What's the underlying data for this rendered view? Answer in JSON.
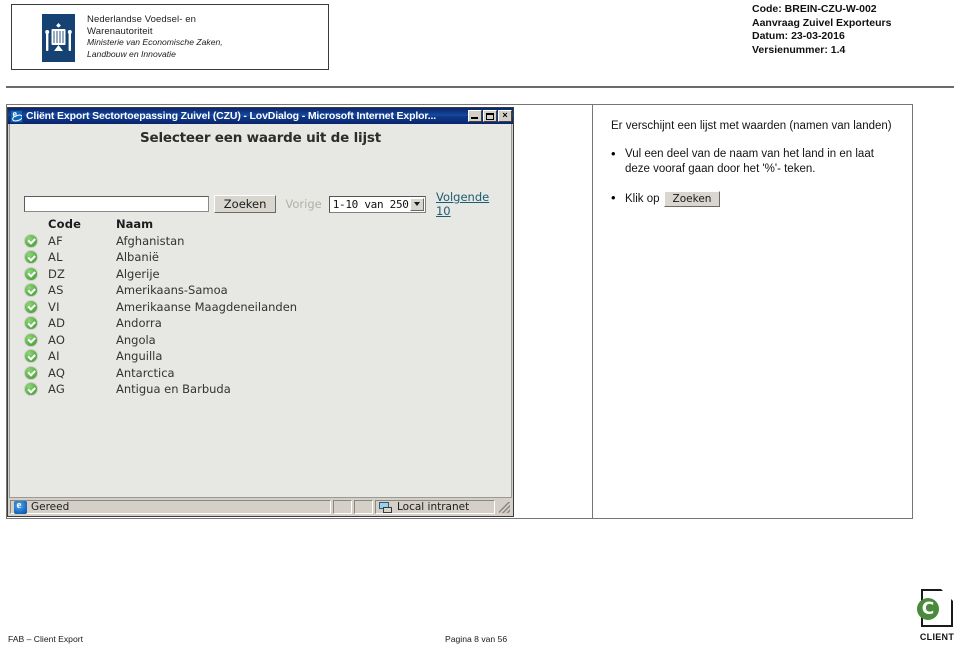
{
  "document_header": {
    "logo": {
      "line1": "Nederlandse Voedsel- en",
      "line2": "Warenautoriteit",
      "line3": "Ministerie van Economische Zaken,",
      "line4": "Landbouw en Innovatie"
    },
    "meta": {
      "code": "Code: BREIN-CZU-W-002",
      "subject": "Aanvraag Zuivel Exporteurs",
      "date": "Datum: 23-03-2016",
      "version": "Versienummer: 1.4"
    }
  },
  "dialog": {
    "title": "Cliënt Export Sectortoepassing Zuivel (CZU) - LovDialog - Microsoft Internet Explor...",
    "window_buttons": {
      "minimize": "minimize-icon",
      "maximize": "maximize-icon",
      "close": "×"
    },
    "heading": "Selecteer een waarde uit de lijst",
    "toolbar": {
      "search_value": "",
      "search_placeholder": "",
      "search_button": "Zoeken",
      "previous_label": "Vorige",
      "range_value": "1-10 van 250",
      "next_link": "Volgende 10"
    },
    "table": {
      "columns": [
        "",
        "Code",
        "Naam"
      ],
      "rows": [
        {
          "code": "AF",
          "naam": "Afghanistan"
        },
        {
          "code": "AL",
          "naam": "Albanië"
        },
        {
          "code": "DZ",
          "naam": "Algerije"
        },
        {
          "code": "AS",
          "naam": "Amerikaans-Samoa"
        },
        {
          "code": "VI",
          "naam": "Amerikaanse Maagdeneilanden"
        },
        {
          "code": "AD",
          "naam": "Andorra"
        },
        {
          "code": "AO",
          "naam": "Angola"
        },
        {
          "code": "AI",
          "naam": "Anguilla"
        },
        {
          "code": "AQ",
          "naam": "Antarctica"
        },
        {
          "code": "AG",
          "naam": "Antigua en Barbuda"
        }
      ]
    },
    "statusbar": {
      "status": "Gereed",
      "zone": "Local intranet"
    }
  },
  "instructions": {
    "intro": "Er verschijnt een lijst met waarden (namen van landen)",
    "bullet_marker": "•",
    "item1": "Vul een deel van de naam van het land in en laat deze vooraf gaan door het '%'- teken.",
    "item2_prefix": "Klik op",
    "item2_button": "Zoeken"
  },
  "footer": {
    "left": "FAB – Client Export",
    "center": "Pagina 8 van 56",
    "logo_letter": "C",
    "logo_label": "CLIENT"
  },
  "colors": {
    "titlebar_blue": "#0a246a",
    "chrome_gray": "#d4d0c8",
    "client_area": "#e7e7e4",
    "brand_blue": "#154273",
    "check_green": "#5cb34a",
    "link_teal": "#1b5c72",
    "client_green": "#4a8a3c"
  }
}
